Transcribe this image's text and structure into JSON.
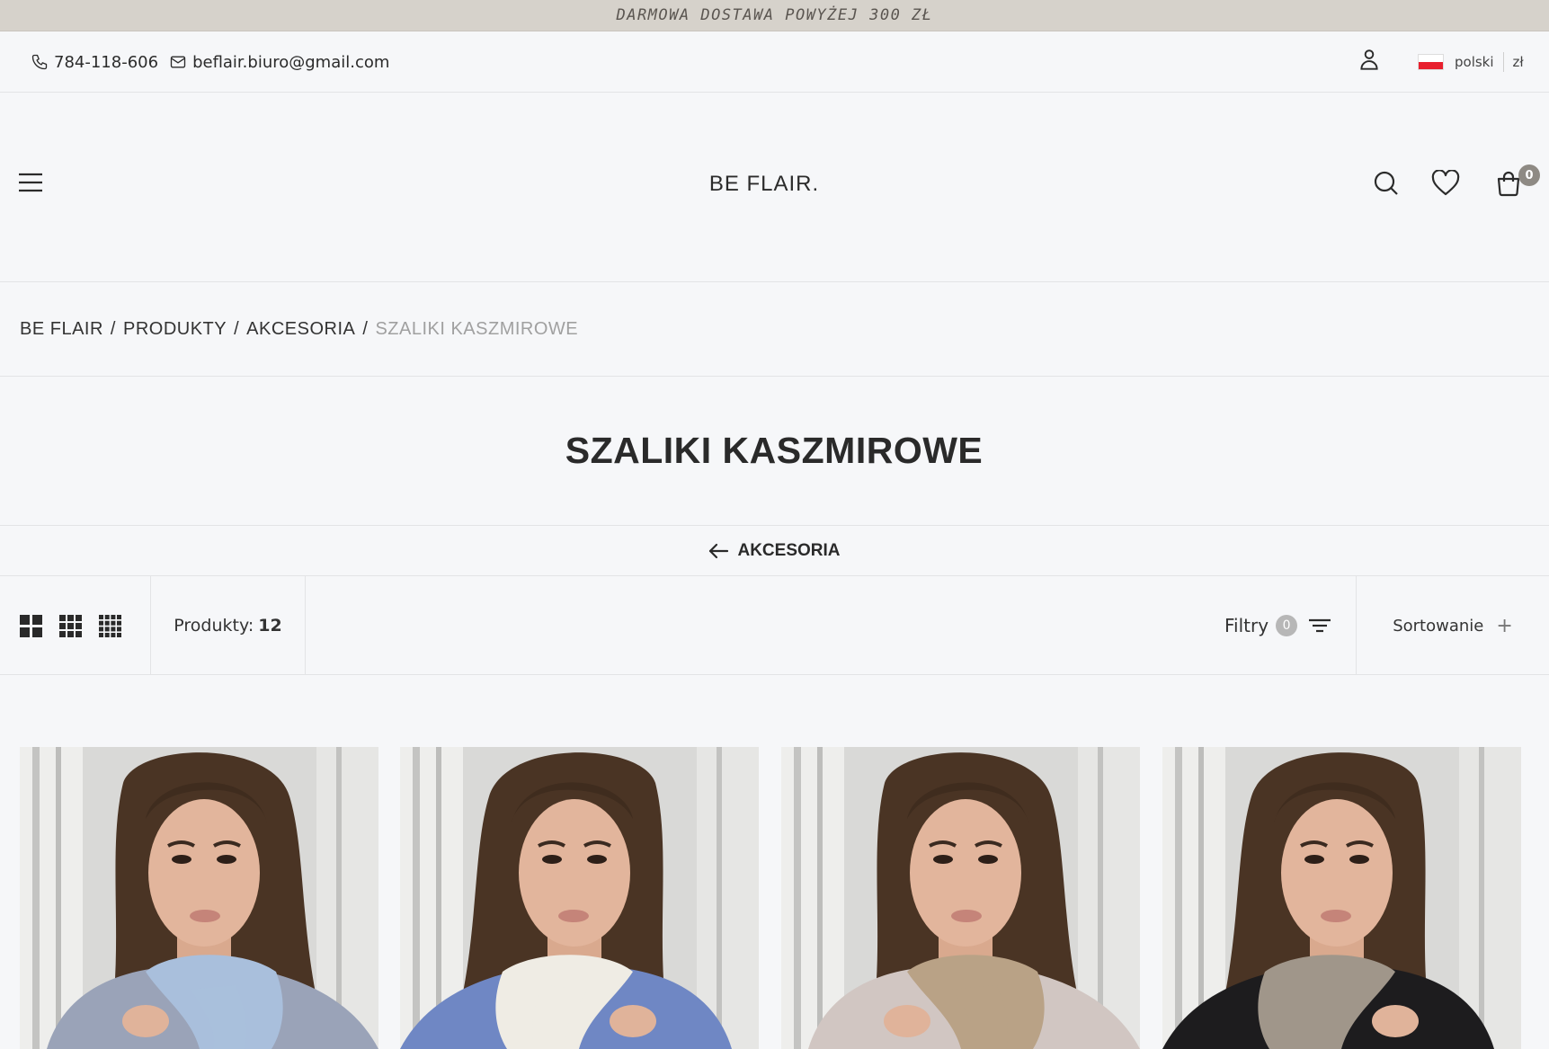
{
  "promo": {
    "text": "DARMOWA DOSTAWA POWYŻEJ 300 ZŁ"
  },
  "contact": {
    "phone": "784-118-606",
    "email": "beflair.biuro@gmail.com"
  },
  "locale": {
    "language": "polski",
    "currency": "zł"
  },
  "header": {
    "logo": "BE FLAIR.",
    "cart_count": "0"
  },
  "breadcrumb": {
    "items": [
      "BE FLAIR",
      "PRODUKTY",
      "AKCESORIA"
    ],
    "separator": "/",
    "current": "SZALIKI KASZMIROWE"
  },
  "page": {
    "title": "SZALIKI KASZMIROWE",
    "back_label": "AKCESORIA"
  },
  "toolbar": {
    "products_label": "Produkty:",
    "products_count": "12",
    "filters_label": "Filtry",
    "filters_count": "0",
    "sort_label": "Sortowanie",
    "sort_icon": "+"
  },
  "products": [
    {
      "scarf_color": "#a9bfdc",
      "sweater_color": "#9aa3b8"
    },
    {
      "scarf_color": "#efece4",
      "sweater_color": "#6f87c4"
    },
    {
      "scarf_color": "#b9a286",
      "sweater_color": "#d1c6c2"
    },
    {
      "scarf_color": "#a0968a",
      "sweater_color": "#1d1c1e"
    }
  ]
}
